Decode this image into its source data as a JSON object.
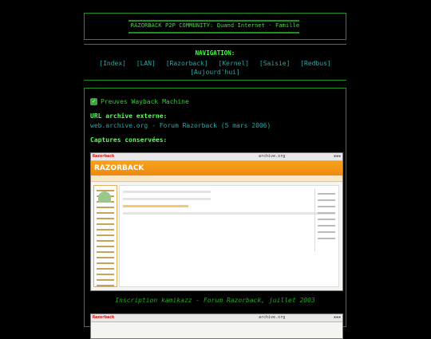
{
  "header": {
    "title": "RAZORBACK P2P COMMUNITY: Quand Internet - Famille"
  },
  "navigation": {
    "heading": "NAVIGATION:",
    "links": [
      "[Index]",
      "[LAN]",
      "[Razorback]",
      "[Kernel]",
      "[Saisie]",
      "[Redbus]",
      "[Aujourd'hui]"
    ]
  },
  "content": {
    "wayback_title": "Preuves Wayback Machine",
    "archive_label": "URL archive externe:",
    "archive_url": "web.archive.org - Forum Razorback (5 mars 2006)",
    "captures_label": "Captures conservées:",
    "captions": [
      "Inscription kamikazz - Forum Razorback, juillet 2003"
    ]
  },
  "screenshot_thumbs": {
    "logo": "Razorback",
    "brand": "RAZORBACK",
    "archive_mark": "archive.org"
  },
  "colors": {
    "background": "#000000",
    "text": "#33cc33",
    "link": "#22aaaa",
    "heading": "#55ff55"
  }
}
